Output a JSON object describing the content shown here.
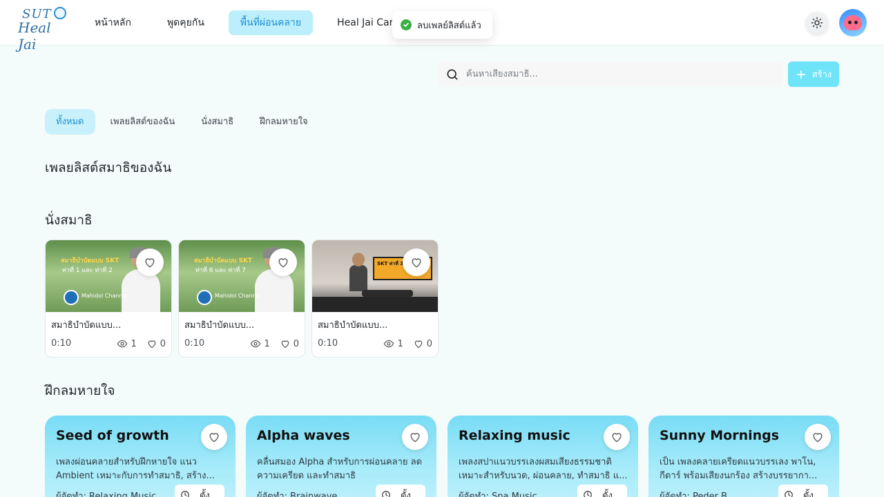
{
  "brand": {
    "line1": "SUT",
    "line2": "Heal Jai"
  },
  "nav": [
    {
      "label": "หน้าหลัก",
      "active": false
    },
    {
      "label": "พูดคุยกัน",
      "active": false
    },
    {
      "label": "พื้นที่ผ่อนคลาย",
      "active": true
    },
    {
      "label": "Heal Jai Care",
      "active": false
    }
  ],
  "toast": {
    "message": "ลบเพลย์ลิสต์แล้ว",
    "status_color": "#3cb043"
  },
  "search": {
    "placeholder": "ค้นหาเสียงสมาธิ..."
  },
  "create_button": {
    "label": "สร้าง"
  },
  "tabs": [
    {
      "label": "ทั้งหมด",
      "active": true
    },
    {
      "label": "เพลยลิสต์ของฉัน",
      "active": false
    },
    {
      "label": "นั่งสมาธิ",
      "active": false
    },
    {
      "label": "ฝึกลมหายใจ",
      "active": false
    }
  ],
  "sections": {
    "my_playlists": "เพลยลิสต์สมาธิของฉัน",
    "meditation": "นั่งสมาธิ",
    "breathing": "ฝึกลมหายใจ"
  },
  "meditation_videos": [
    {
      "name": "สมาธิบำบัดแบบ...",
      "duration": "0:10",
      "views": "1",
      "likes": "0",
      "thumb_title": "สมาธิบำบัดแบบ SKT",
      "thumb_subtitle": "ท่าที่ 1 และ ท่าที่ 2",
      "channel": "Mahidol Channel"
    },
    {
      "name": "สมาธิบำบัดแบบ...",
      "duration": "0:10",
      "views": "1",
      "likes": "0",
      "thumb_title": "สมาธิบำบัดแบบ SKT",
      "thumb_subtitle": "ท่าที่ 6 และ ท่าที่ 7",
      "channel": "Mahidol Channel"
    },
    {
      "name": "สมาธิบำบัดแบบ...",
      "duration": "0:10",
      "views": "1",
      "likes": "0",
      "thumb_title": "SKT ท่าที่ 3",
      "thumb_subtitle": "",
      "channel": ""
    }
  ],
  "breathing_playlists": [
    {
      "title": "Seed of growth",
      "description": "เพลงผ่อนคลายสำหรับฝึกหายใจ แนว Ambient เหมาะกับการทำสมาธิ, สร้าง...",
      "author": "ผู้จัดทำ: Relaxing Music",
      "timer_label": "ตั้ง"
    },
    {
      "title": "Alpha waves",
      "description": "คลื่นสมอง Alpha สำหรับการผ่อนคลาย ลดความเครียด และทำสมาธิ",
      "author": "ผู้จัดทำ: Brainwave",
      "timer_label": "ตั้ง"
    },
    {
      "title": "Relaxing music",
      "description": "เพลงสปาแนวบรรเลงผสมเสียงธรรมชาติ เหมาะสำหรับนวด, ผ่อนคลาย, ทำสมาธิ แ...",
      "author": "ผู้จัดทำ: Spa Music",
      "timer_label": "ตั้ง"
    },
    {
      "title": "Sunny Mornings",
      "description": "เป็น เพลงคลายเครียดแนวบรรเลง พาโน, กีตาร์ พร้อมเสียงนกร้อง สร้างบรรยากา...",
      "author": "ผู้จัดทำ: Peder B.",
      "timer_label": "ตั้ง"
    }
  ],
  "colors": {
    "accent": "#1b8fd6",
    "nav_active_bg": "#bdeefb",
    "create_btn": "#6fe3f7",
    "card_gradient_top": "#78dcf5"
  }
}
